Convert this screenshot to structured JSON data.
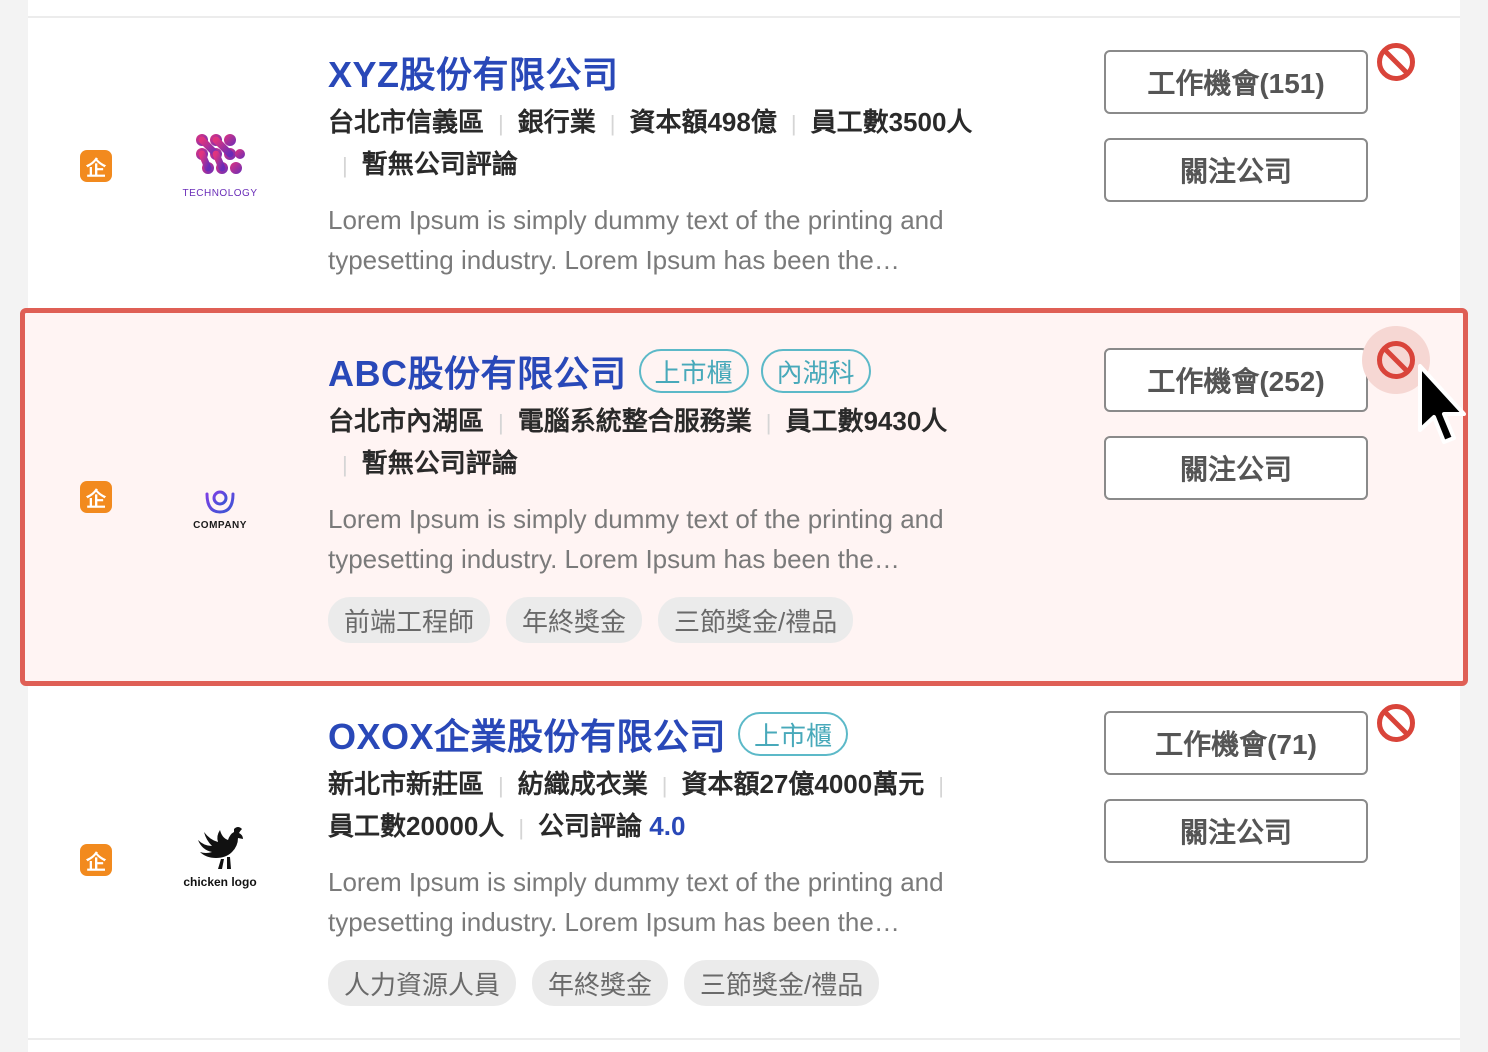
{
  "companies": [
    {
      "name": "XYZ股份有限公司",
      "badge": "企",
      "logo_caption": "TECHNOLOGY",
      "tags": [],
      "meta": {
        "location": "台北市信義區",
        "industry": "銀行業",
        "capital": "資本額498億",
        "employees": "員工數3500人",
        "review": "暫無公司評論"
      },
      "description": "Lorem Ipsum is simply dummy text of the printing and typesetting industry. Lorem Ipsum has been the…",
      "chips": [],
      "jobs_button": "工作機會(151)",
      "follow_button": "關注公司"
    },
    {
      "name": "ABC股份有限公司",
      "badge": "企",
      "logo_caption": "COMPANY",
      "tags": [
        "上市櫃",
        "內湖科"
      ],
      "meta": {
        "location": "台北市內湖區",
        "industry": "電腦系統整合服務業",
        "employees": "員工數9430人",
        "review": "暫無公司評論"
      },
      "description": "Lorem Ipsum is simply dummy text of the printing and typesetting industry. Lorem Ipsum has been the…",
      "chips": [
        "前端工程師",
        "年終獎金",
        "三節獎金/禮品"
      ],
      "jobs_button": "工作機會(252)",
      "follow_button": "關注公司"
    },
    {
      "name": "OXOX企業股份有限公司",
      "badge": "企",
      "logo_caption": "chicken logo",
      "tags": [
        "上市櫃"
      ],
      "meta": {
        "location": "新北市新莊區",
        "industry": "紡織成衣業",
        "capital": "資本額27億4000萬元",
        "employees": "員工數20000人",
        "review_label": "公司評論",
        "review_score": "4.0"
      },
      "description": "Lorem Ipsum is simply dummy text of the printing and typesetting industry. Lorem Ipsum has been the…",
      "chips": [
        "人力資源人員",
        "年終獎金",
        "三節獎金/禮品"
      ],
      "jobs_button": "工作機會(71)",
      "follow_button": "關注公司"
    }
  ],
  "colors": {
    "title": "#2948b8",
    "highlight_border": "#df5f55",
    "highlight_bg": "#fff4f3",
    "enterprise_badge": "#f28a1e",
    "tag_pill": "#5cb9c8",
    "block_icon": "#d9443a"
  },
  "icons": {
    "block": "block-icon",
    "cursor": "mouse-pointer-icon"
  }
}
